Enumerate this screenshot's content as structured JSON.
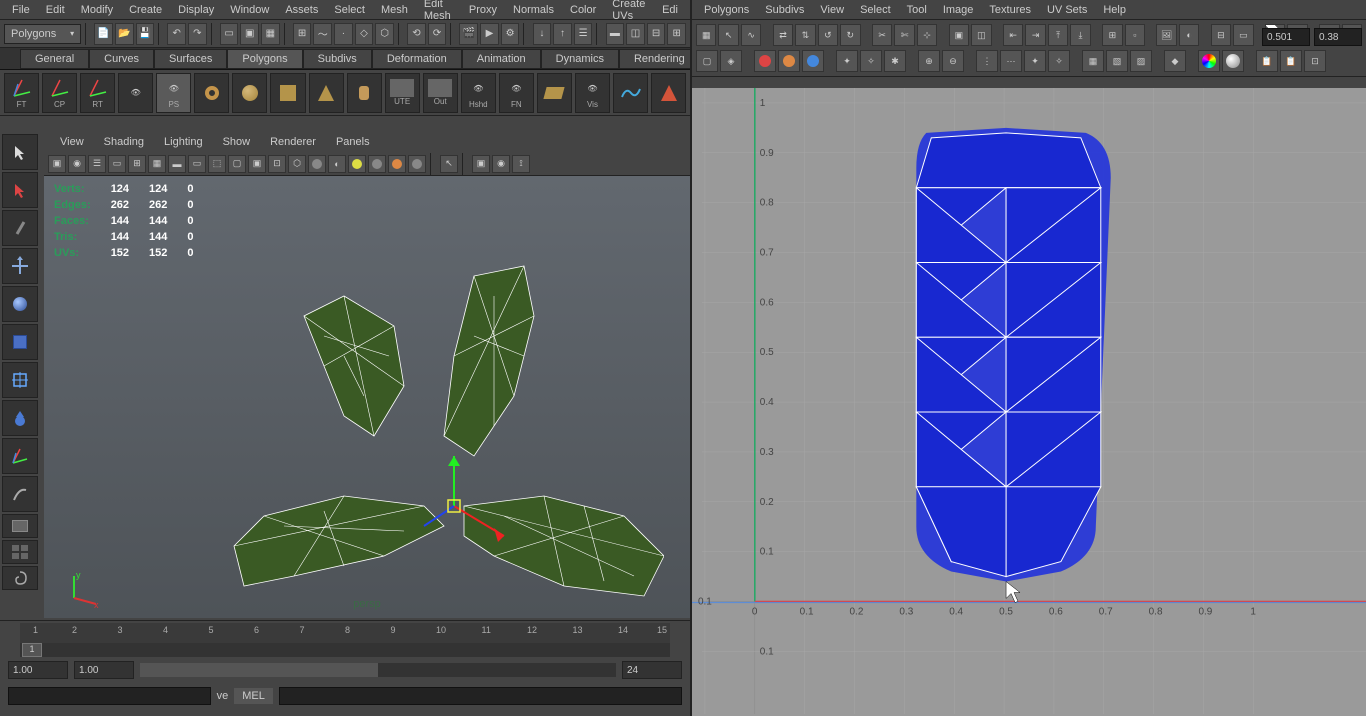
{
  "main_menu": [
    "File",
    "Edit",
    "Modify",
    "Create",
    "Display",
    "Window",
    "Assets",
    "Select",
    "Mesh",
    "Edit Mesh",
    "Proxy",
    "Normals",
    "Color",
    "Create UVs",
    "Edi"
  ],
  "mode_dropdown": "Polygons",
  "shelf_tabs": [
    "General",
    "Curves",
    "Surfaces",
    "Polygons",
    "Subdivs",
    "Deformation",
    "Animation",
    "Dynamics",
    "Rendering"
  ],
  "shelf_items": [
    "FT",
    "CP",
    "RT",
    "",
    "PS",
    "",
    "",
    "",
    "",
    "",
    "UTE",
    "Out",
    "Hshd",
    "FN",
    "",
    "Vis",
    "",
    ""
  ],
  "vp_menu": [
    "View",
    "Shading",
    "Lighting",
    "Show",
    "Renderer",
    "Panels"
  ],
  "hud": {
    "rows": [
      {
        "label": "Verts:",
        "a": "124",
        "b": "124",
        "c": "0"
      },
      {
        "label": "Edges:",
        "a": "262",
        "b": "262",
        "c": "0"
      },
      {
        "label": "Faces:",
        "a": "144",
        "b": "144",
        "c": "0"
      },
      {
        "label": "Tris:",
        "a": "144",
        "b": "144",
        "c": "0"
      },
      {
        "label": "UVs:",
        "a": "152",
        "b": "152",
        "c": "0"
      }
    ]
  },
  "camera_label": "persp",
  "timeline": {
    "ticks": [
      "1",
      "2",
      "3",
      "4",
      "5",
      "6",
      "7",
      "8",
      "9",
      "10",
      "11",
      "12",
      "13",
      "14",
      "15"
    ],
    "current": "1"
  },
  "range": {
    "start": "1.00",
    "playback_start": "1.00",
    "end": "24"
  },
  "cmd": {
    "prompt": "ve",
    "lang": "MEL"
  },
  "uv_menu": [
    "Polygons",
    "Subdivs",
    "View",
    "Select",
    "Tool",
    "Image",
    "Textures",
    "UV Sets",
    "Help"
  ],
  "uv_coords": {
    "u": "0.501",
    "v": "0.38"
  },
  "uv_axis_ticks_x": [
    "0.1",
    "0",
    "0.1",
    "0.2",
    "0.3",
    "0.4",
    "0.5",
    "0.6",
    "0.7",
    "0.8",
    "0.9",
    "1"
  ],
  "uv_axis_ticks_y": [
    "0.1",
    "0.2",
    "0.3",
    "0.4",
    "0.5",
    "0.6",
    "0.7",
    "0.8",
    "0.9",
    "1",
    "0.1"
  ],
  "axis_labels": {
    "x": "x",
    "y": "y"
  }
}
